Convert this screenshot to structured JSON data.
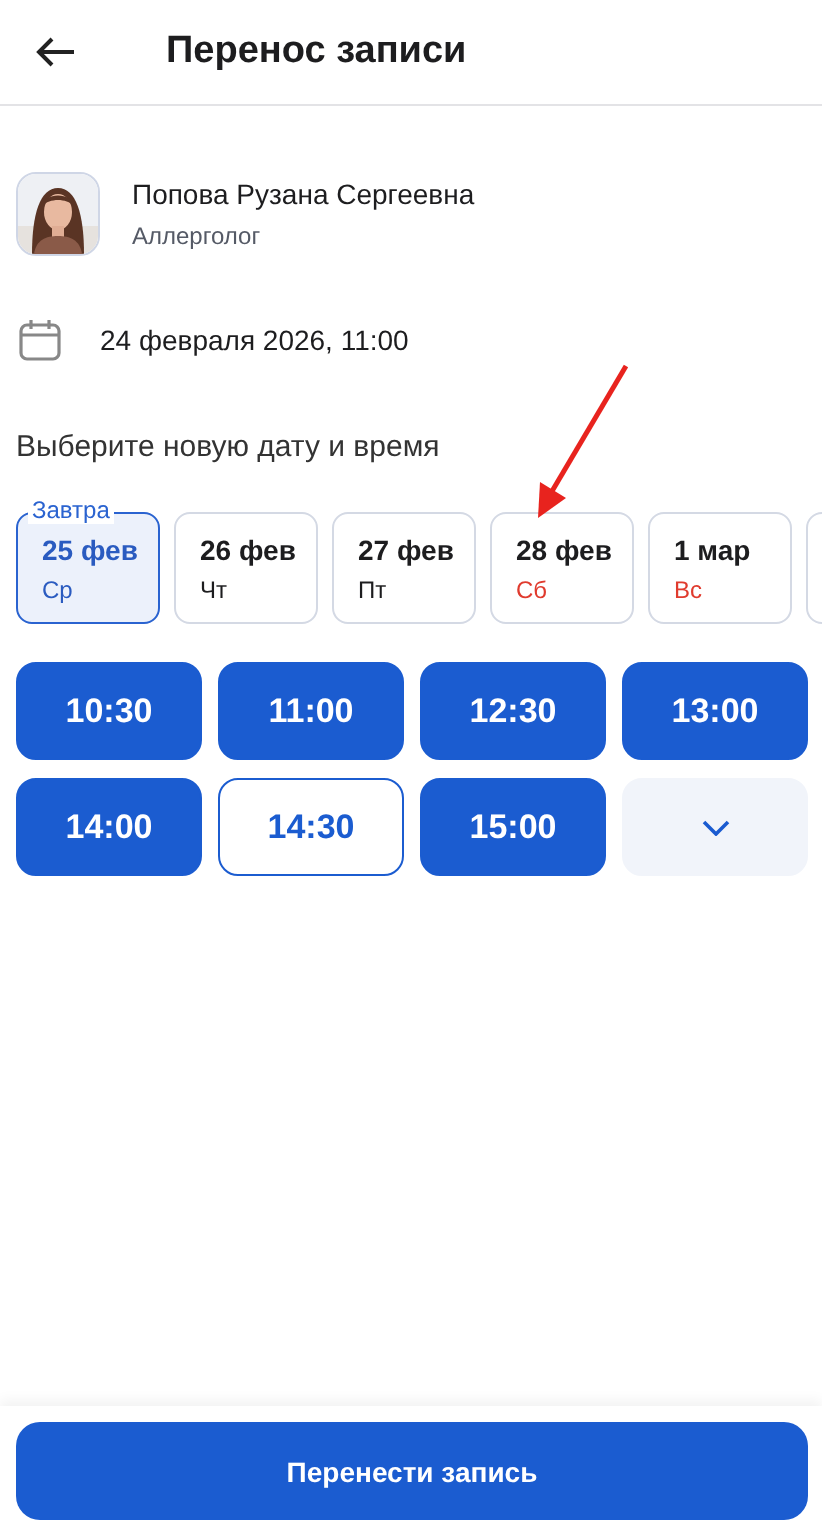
{
  "header": {
    "title": "Перенос записи"
  },
  "doctor": {
    "name": "Попова Рузана Сергеевна",
    "specialty": "Аллерголог"
  },
  "current_appointment": "24 февраля 2026, 11:00",
  "prompt": "Выберите новую дату и время",
  "dates": [
    {
      "badge": "Завтра",
      "date": "25 фев",
      "weekday": "Ср",
      "weekend": false,
      "selected": true
    },
    {
      "date": "26 фев",
      "weekday": "Чт",
      "weekend": false,
      "selected": false
    },
    {
      "date": "27 фев",
      "weekday": "Пт",
      "weekend": false,
      "selected": false
    },
    {
      "date": "28 фев",
      "weekday": "Сб",
      "weekend": true,
      "selected": false
    },
    {
      "date": "1 мар",
      "weekday": "Вс",
      "weekend": true,
      "selected": false
    }
  ],
  "dates_continue": true,
  "slots": [
    {
      "kind": "time",
      "label": "10:30",
      "selected": false
    },
    {
      "kind": "time",
      "label": "11:00",
      "selected": false
    },
    {
      "kind": "time",
      "label": "12:30",
      "selected": false
    },
    {
      "kind": "time",
      "label": "13:00",
      "selected": false
    },
    {
      "kind": "time",
      "label": "14:00",
      "selected": false
    },
    {
      "kind": "time",
      "label": "14:30",
      "selected": true
    },
    {
      "kind": "time",
      "label": "15:00",
      "selected": false
    },
    {
      "kind": "expand"
    }
  ],
  "submit_button": "Перенести запись"
}
